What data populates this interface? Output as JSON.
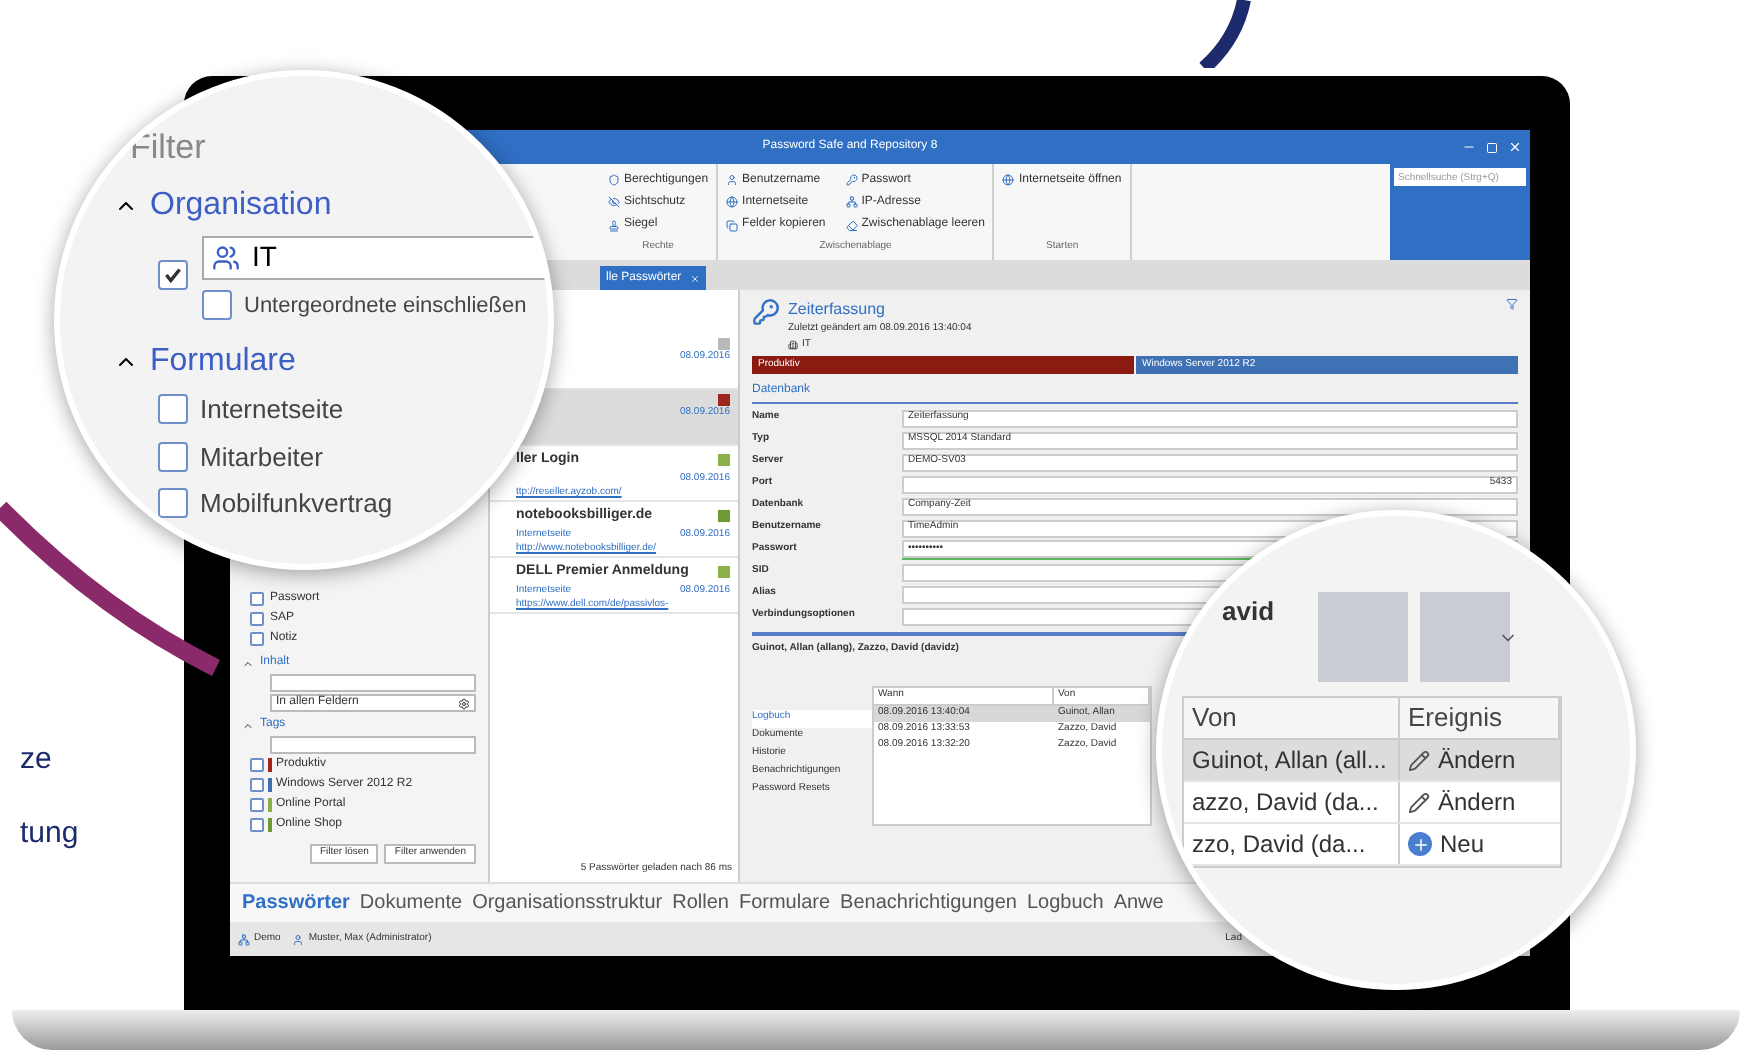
{
  "page_fragments": [
    "ze",
    "tung"
  ],
  "window": {
    "title": "Password Safe and Repository 8",
    "search": {
      "placeholder": "Schnellsuche (Strg+Q)"
    }
  },
  "ribbon": {
    "groups": [
      {
        "label": "Rechte",
        "items": [
          "Berechtigungen",
          "Sichtschutz",
          "Siegel"
        ]
      },
      {
        "label": "Zwischenablage",
        "items": [
          "Benutzername",
          "Internetseite",
          "Felder kopieren",
          "Passwort",
          "IP-Adresse",
          "Zwischenablage leeren"
        ]
      },
      {
        "label": "Starten",
        "items": [
          "Internetseite öffnen"
        ]
      }
    ]
  },
  "document_tab": {
    "label": "lle Passwörter"
  },
  "filter": {
    "options": [
      {
        "label": "Passwort",
        "checked": false
      },
      {
        "label": "SAP",
        "checked": false
      },
      {
        "label": "Notiz",
        "checked": false
      }
    ],
    "content": {
      "title": "Inhalt",
      "expanded": true,
      "scope": "In allen Feldern"
    },
    "tags": {
      "title": "Tags",
      "expanded": true,
      "items": [
        {
          "label": "Produktiv",
          "color": "#a0261c",
          "checked": false
        },
        {
          "label": "Windows Server 2012 R2",
          "color": "#3f6fb0",
          "checked": false
        },
        {
          "label": "Online Portal",
          "color": "#8db04a",
          "checked": false
        },
        {
          "label": "Online Shop",
          "color": "#6f9a35",
          "checked": false
        }
      ]
    },
    "buttons": [
      "Filter lösen",
      "Filter anwenden"
    ]
  },
  "list": {
    "entries": [
      {
        "date": "08.09.2016",
        "color": "#b8b8b8",
        "selected": false
      },
      {
        "date": "08.09.2016",
        "color": "#a0261c",
        "selected": true
      },
      {
        "title": "ller Login",
        "url": "ttp://reseller.ayzob.com/",
        "date": "08.09.2016",
        "color": "#8db04a",
        "selected": false
      },
      {
        "title": "notebooksbilliger.de",
        "subtitle": "Internetseite",
        "url": "http://www.notebooksbilliger.de/",
        "date": "08.09.2016",
        "color": "#6f9a35",
        "selected": false
      },
      {
        "title": "DELL Premier Anmeldung",
        "subtitle": "Internetseite",
        "url": "https://www.dell.com/de/passivlos-",
        "date": "08.09.2016",
        "color": "#8db04a",
        "selected": false
      }
    ],
    "footer": "5 Passwörter geladen nach 86 ms"
  },
  "detail": {
    "title": "Zeiterfassung",
    "modified": "Zuletzt geändert am 08.09.2016 13:40:04",
    "organisation": "IT",
    "tags": [
      {
        "label": "Produktiv",
        "color": "#8b1a10"
      },
      {
        "label": "Windows Server 2012 R2",
        "color": "#3f72b5"
      }
    ],
    "section": "Datenbank",
    "fields": [
      {
        "label": "Name",
        "value": "Zeiterfassung"
      },
      {
        "label": "Typ",
        "value": "MSSQL 2014 Standard"
      },
      {
        "label": "Server",
        "value": "DEMO-SV03"
      },
      {
        "label": "Port",
        "value": "5433",
        "kind": "number"
      },
      {
        "label": "Datenbank",
        "value": "Company-Zeit"
      },
      {
        "label": "Benutzername",
        "value": "TimeAdmin"
      },
      {
        "label": "Passwort",
        "value": "••••••••••",
        "kind": "password",
        "level": 1
      },
      {
        "label": "SID"
      },
      {
        "label": "Alias"
      },
      {
        "label": "Verbindungsoptionen"
      }
    ],
    "owners": "Guinot, Allan (allang), Zazzo, David (davidz)",
    "log_nav": [
      {
        "label": "Logbuch",
        "selected": true
      },
      {
        "label": "Dokumente",
        "selected": false
      },
      {
        "label": "Historie",
        "selected": false
      },
      {
        "label": "Benachrichtigungen",
        "selected": false
      },
      {
        "label": "Password Resets",
        "selected": false
      }
    ],
    "log_table": {
      "columns": [
        "Wann",
        "Von"
      ],
      "rows": [
        {
          "cells": [
            "08.09.2016 13:40:04",
            "Guinot, Allan"
          ],
          "selected": true
        },
        {
          "cells": [
            "08.09.2016 13:33:53",
            "Zazzo, David"
          ],
          "selected": false
        },
        {
          "cells": [
            "08.09.2016 13:32:20",
            "Zazzo, David"
          ],
          "selected": false
        }
      ]
    }
  },
  "bottom_nav": [
    {
      "label": "Passwörter",
      "selected": true
    },
    {
      "label": "Dokumente",
      "selected": false
    },
    {
      "label": "Organisationsstruktur",
      "selected": false
    },
    {
      "label": "Rollen",
      "selected": false
    },
    {
      "label": "Formulare",
      "selected": false
    },
    {
      "label": "Benachrichtigungen",
      "selected": false
    },
    {
      "label": "Logbuch",
      "selected": false
    },
    {
      "label": "Anwe",
      "selected": false
    }
  ],
  "status_bar": {
    "items": [
      "Demo",
      "Muster, Max (Administrator)"
    ],
    "right": "Lad"
  },
  "magnifier_filter": {
    "title": "Filter",
    "organisation": {
      "title": "Organisation",
      "expanded": true,
      "checked": true,
      "value": "IT",
      "include_children": {
        "label": "Untergeordnete einschließen",
        "checked": false
      }
    },
    "forms": {
      "title": "Formulare",
      "expanded": true,
      "items": [
        {
          "label": "Internetseite",
          "checked": false
        },
        {
          "label": "Mitarbeiter",
          "checked": false
        },
        {
          "label": "Mobilfunkvertrag",
          "checked": false
        }
      ]
    }
  },
  "magnifier_log": {
    "name": "avid",
    "columns": [
      "Von",
      "Ereignis"
    ],
    "rows": [
      {
        "von": "Guinot, Allan (all...",
        "event": "Ändern",
        "kind": "edit",
        "selected": true
      },
      {
        "von": "azzo, David (da...",
        "event": "Ändern",
        "kind": "edit",
        "selected": false
      },
      {
        "von": "zzo, David (da...",
        "event": "Neu",
        "kind": "new",
        "selected": false
      }
    ]
  }
}
